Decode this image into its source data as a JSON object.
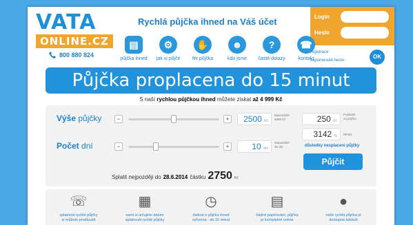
{
  "header": {
    "logo_top": "VATA",
    "logo_bottom": "ONLINE.CZ",
    "tagline": "Rychlá půjčka ihned na Váš účet",
    "phone": "800 880 824"
  },
  "login": {
    "login_label": "Login",
    "password_label": "Heslo",
    "registration": "registrace",
    "forgot": "zapomenuté heslo",
    "ok": "OK"
  },
  "nav": {
    "items": [
      {
        "label": "půjčka ihned",
        "icon": "document-icon"
      },
      {
        "label": "jak si půjčit",
        "icon": "gears-icon"
      },
      {
        "label": "fér půjčka",
        "icon": "handshake-icon"
      },
      {
        "label": "kdo jsme",
        "icon": "people-icon"
      },
      {
        "label": "časté dotazy",
        "icon": "question-icon"
      },
      {
        "label": "kontakt",
        "icon": "phone-icon"
      }
    ]
  },
  "banner": {
    "title": "Půjčka proplacena do 15 minut",
    "sub_prefix": "S naší",
    "sub_bold1": "rychlou půjčkou ihned",
    "sub_mid": "můžete získat",
    "sub_bold2": "až 4 999 Kč"
  },
  "calc": {
    "amount_label_bold": "Výše",
    "amount_label_rest": "půjčky",
    "amount_value": "2500",
    "amount_unit": "Kč",
    "amount_max_line1": "Maximálně",
    "amount_max_line2": "4999 Kč",
    "amount_slider_fraction": 0.5,
    "days_label_bold": "Počet",
    "days_label_rest": "dní",
    "days_value": "10",
    "days_unit": "dní",
    "days_max_line1": "Maximálně",
    "days_max_line2": "35 dní",
    "days_slider_fraction": 0.29,
    "minus": "−",
    "plus": "+",
    "fee_value": "250",
    "fee_unit": "Kč",
    "fee_note_line1": "Poplatek",
    "fee_note_line2": "za půjčku",
    "rpsn_value": "3142",
    "rpsn_unit": "%",
    "rpsn_label": "RPSN",
    "consequences": "důsledky nesplacení půjčky",
    "borrow_button": "Půjčit",
    "repay_text": "Splatit nejpozději do",
    "repay_date": "28.6.2014",
    "repay_amount_label": "částku",
    "repay_amount": "2750",
    "repay_currency": "Kč"
  },
  "features": [
    {
      "icon": "phone-device-icon",
      "text1": "splatnost rychlé půjčky",
      "text2": "si můžete prodloužit"
    },
    {
      "icon": "calendar-icon",
      "text1": "sami si určujete datum",
      "text2": "splatnosti rychlé půjčky"
    },
    {
      "icon": "stopwatch-icon",
      "text1": "žádost o půjčku ihned",
      "text2": "vyřízena - do 15 minut"
    },
    {
      "icon": "documents-icon",
      "text1": "žádné papírování, půjčka",
      "text2": "je kompletně online"
    },
    {
      "icon": "globe-icon",
      "text1": "naše rychlá půjčka je",
      "text2": "dostupná kdekoli"
    }
  ]
}
